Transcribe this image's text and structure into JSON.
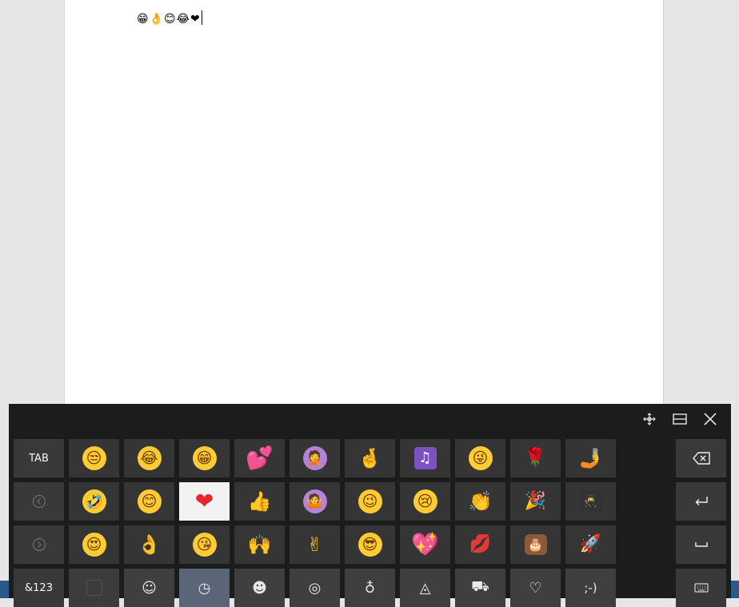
{
  "document": {
    "text": "😁👌😊😂❤"
  },
  "keyboard": {
    "controls": {
      "move_icon": "move-icon",
      "dock_icon": "dock-icon",
      "close_icon": "close-icon"
    },
    "left_keys": {
      "tab_label": "TAB",
      "prev_symbol": "‹",
      "next_symbol": "›",
      "numbers_label": "&123"
    },
    "emoji_rows": [
      [
        {
          "name": "unamused-face",
          "glyph": "😒",
          "style": "face"
        },
        {
          "name": "tears-of-joy-face",
          "glyph": "😂",
          "style": "face"
        },
        {
          "name": "grinning-face",
          "glyph": "😁",
          "style": "face"
        },
        {
          "name": "two-hearts",
          "glyph": "💕",
          "style": "heart"
        },
        {
          "name": "person-facepalming",
          "glyph": "🤦",
          "style": "person"
        },
        {
          "name": "crossed-fingers",
          "glyph": "🤞",
          "style": "hand"
        },
        {
          "name": "musical-notes",
          "glyph": "♫",
          "style": "music"
        },
        {
          "name": "winking-tongue-face",
          "glyph": "😜",
          "style": "face"
        },
        {
          "name": "rose",
          "glyph": "🌹",
          "style": "rose"
        },
        {
          "name": "selfie",
          "glyph": "🤳",
          "style": "hand"
        }
      ],
      [
        {
          "name": "rolling-laughing-face",
          "glyph": "🤣",
          "style": "face"
        },
        {
          "name": "smiling-eyes-face",
          "glyph": "😊",
          "style": "face"
        },
        {
          "name": "red-heart",
          "glyph": "❤",
          "style": "heart",
          "selected": true
        },
        {
          "name": "thumbs-up",
          "glyph": "👍",
          "style": "hand"
        },
        {
          "name": "person-shrugging",
          "glyph": "🤷",
          "style": "person"
        },
        {
          "name": "winking-face",
          "glyph": "😉",
          "style": "face"
        },
        {
          "name": "crying-face",
          "glyph": "😢",
          "style": "face"
        },
        {
          "name": "clapping-hands",
          "glyph": "👏",
          "style": "hand"
        },
        {
          "name": "party-popper",
          "glyph": "🎉",
          "style": "party"
        },
        {
          "name": "ninja",
          "glyph": "🥷",
          "style": "ninja"
        }
      ],
      [
        {
          "name": "heart-eyes-face",
          "glyph": "😍",
          "style": "face"
        },
        {
          "name": "ok-hand",
          "glyph": "👌",
          "style": "hand"
        },
        {
          "name": "kissing-face",
          "glyph": "😘",
          "style": "face"
        },
        {
          "name": "raising-hands",
          "glyph": "🙌",
          "style": "hand"
        },
        {
          "name": "victory-hand",
          "glyph": "✌",
          "style": "hand"
        },
        {
          "name": "sunglasses-face",
          "glyph": "😎",
          "style": "face"
        },
        {
          "name": "sparkling-heart",
          "glyph": "💖",
          "style": "heart"
        },
        {
          "name": "kiss-mark",
          "glyph": "💋",
          "style": "lips"
        },
        {
          "name": "birthday-cake",
          "glyph": "🎂",
          "style": "cake"
        },
        {
          "name": "rocket",
          "glyph": "🚀",
          "style": "rocket"
        }
      ]
    ],
    "categories": [
      {
        "name": "blank",
        "glyph": ""
      },
      {
        "name": "smiley-category",
        "glyph": "☺"
      },
      {
        "name": "recent-category",
        "glyph": "◷",
        "active": true
      },
      {
        "name": "people-category",
        "glyph": "☻"
      },
      {
        "name": "person-category",
        "glyph": "◎"
      },
      {
        "name": "celebration-category",
        "glyph": "♁"
      },
      {
        "name": "food-category",
        "glyph": "◬"
      },
      {
        "name": "travel-category",
        "glyph": "⛟"
      },
      {
        "name": "heart-category",
        "glyph": "♡"
      },
      {
        "name": "emoticon-category",
        "glyph": ";-)"
      }
    ],
    "right_keys": {
      "backspace_symbol": "⌫",
      "enter_symbol": "↵",
      "space_symbol": "␣",
      "keyboard_symbol": "⌨"
    }
  }
}
